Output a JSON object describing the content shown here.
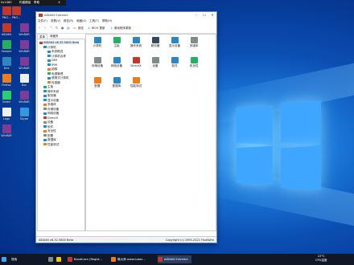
{
  "recorder": {
    "res": "0x1080",
    "menu1": "构建模组",
    "menu2": "帮助"
  },
  "desktop_icons": [
    {
      "label": "PNG...",
      "color": "#c0392b"
    },
    {
      "label": "PNG...",
      "color": "#c0392b"
    },
    {
      "label": "AIDA64",
      "color": "#c0392b"
    },
    {
      "label": "WinRAR",
      "color": "#7d3c98"
    },
    {
      "label": "Sample",
      "color": "#27ae60"
    },
    {
      "label": "WinRAR",
      "color": "#7d3c98"
    },
    {
      "label": "Bird",
      "color": "#2e86c1"
    },
    {
      "label": "WinRAR",
      "color": "#7d3c98"
    },
    {
      "label": "Firefox",
      "color": "#e67e22"
    },
    {
      "label": "Doc",
      "color": "#ecf0f1"
    },
    {
      "label": "Green",
      "color": "#2ecc71"
    },
    {
      "label": "WinRAR",
      "color": "#7d3c98"
    },
    {
      "label": "Logo",
      "color": "#ecf0f1"
    },
    {
      "label": "Skype",
      "color": "#3498db"
    },
    {
      "label": "WinRAR",
      "color": "#7d3c98"
    }
  ],
  "window": {
    "title": "AIDA64 Extreme",
    "menu": [
      "文件(F)",
      "查看(V)",
      "报告(R)",
      "收藏(O)",
      "工具(T)",
      "帮助(H)"
    ],
    "toolbar": {
      "report": "报告",
      "bios": "BIOS 更新",
      "driver": "驱动程序更新"
    },
    "tabs": [
      "菜单",
      "收藏夹"
    ],
    "tree": [
      {
        "label": "AIDA64 v6.32.5600 Beta",
        "level": 0,
        "color": "#c0392b"
      },
      {
        "label": "计算机",
        "level": 1,
        "color": "#2e86c1"
      },
      {
        "label": "系统概述",
        "level": 2,
        "color": "#2e86c1"
      },
      {
        "label": "计算机名称",
        "level": 2,
        "color": "#2e86c1"
      },
      {
        "label": "DMI",
        "level": 2,
        "color": "#2e86c1"
      },
      {
        "label": "IPMI",
        "level": 2,
        "color": "#2e86c1"
      },
      {
        "label": "超频",
        "level": 2,
        "color": "#e67e22"
      },
      {
        "label": "电源管理",
        "level": 2,
        "color": "#27ae60"
      },
      {
        "label": "便携式计算机",
        "level": 2,
        "color": "#2e86c1"
      },
      {
        "label": "传感器",
        "level": 2,
        "color": "#e67e22"
      },
      {
        "label": "主板",
        "level": 1,
        "color": "#27ae60"
      },
      {
        "label": "操作系统",
        "level": 1,
        "color": "#2e86c1"
      },
      {
        "label": "服务器",
        "level": 1,
        "color": "#2e86c1"
      },
      {
        "label": "显示设备",
        "level": 1,
        "color": "#2e86c1"
      },
      {
        "label": "多媒体",
        "level": 1,
        "color": "#e67e22"
      },
      {
        "label": "存储设备",
        "level": 1,
        "color": "#7f8c8d"
      },
      {
        "label": "网络设备",
        "level": 1,
        "color": "#2e86c1"
      },
      {
        "label": "DirectX",
        "level": 1,
        "color": "#c0392b"
      },
      {
        "label": "设备",
        "level": 1,
        "color": "#7f8c8d"
      },
      {
        "label": "软件",
        "level": 1,
        "color": "#2e86c1"
      },
      {
        "label": "安全性",
        "level": 1,
        "color": "#e67e22"
      },
      {
        "label": "配置",
        "level": 1,
        "color": "#7f8c8d"
      },
      {
        "label": "数据库",
        "level": 1,
        "color": "#2e86c1"
      },
      {
        "label": "性能测试",
        "level": 1,
        "color": "#e67e22"
      }
    ],
    "categories": [
      {
        "label": "计算机",
        "color": "#2e86c1"
      },
      {
        "label": "主板",
        "color": "#27ae60"
      },
      {
        "label": "操作系统",
        "color": "#2e86c1"
      },
      {
        "label": "服务器",
        "color": "#34495e"
      },
      {
        "label": "显示设备",
        "color": "#2e86c1"
      },
      {
        "label": "多媒体",
        "color": "#7f8c8d"
      },
      {
        "label": "存储设备",
        "color": "#7f8c8d"
      },
      {
        "label": "网络设备",
        "color": "#2e86c1"
      },
      {
        "label": "DirectX",
        "color": "#c0392b"
      },
      {
        "label": "设备",
        "color": "#7f8c8d"
      },
      {
        "label": "软件",
        "color": "#2e86c1"
      },
      {
        "label": "安全性",
        "color": "#27ae60"
      },
      {
        "label": "配置",
        "color": "#e67e22"
      },
      {
        "label": "数据库",
        "color": "#2e86c1"
      },
      {
        "label": "性能测试",
        "color": "#e67e22"
      }
    ],
    "status_left": "AIDA64 v6.32.5600 Beta",
    "status_right": "Copyright (c) 1995-2021 FinalWire"
  },
  "taskbar": {
    "start": "搜索",
    "items": [
      "Bandicam (Regist...",
      "微大师 www.ludas...",
      "AIDA64 Extreme"
    ],
    "weather": "22°C",
    "clock": "CPU温度"
  }
}
